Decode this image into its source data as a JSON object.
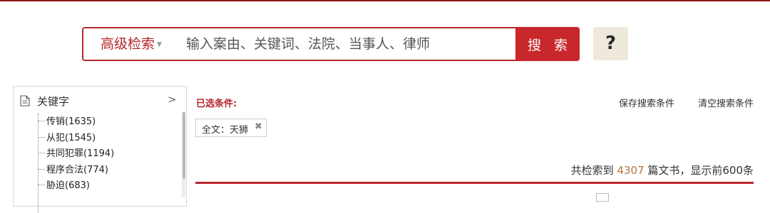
{
  "search": {
    "advanced_label": "高级检索",
    "placeholder": "输入案由、关键词、法院、当事人、律师",
    "value": "",
    "button_label": "搜 索",
    "help_label": "?"
  },
  "sidebar": {
    "title": "关键字",
    "arrow": ">",
    "items": [
      {
        "label": "传销(1635)"
      },
      {
        "label": "从犯(1545)"
      },
      {
        "label": "共同犯罪(1194)"
      },
      {
        "label": "程序合法(774)"
      },
      {
        "label": "胁迫(683)"
      }
    ]
  },
  "filters": {
    "selected_label": "已选条件:",
    "save_label": "保存搜索条件",
    "clear_label": "清空搜索条件",
    "chips": [
      {
        "text": "全文：天狮"
      }
    ]
  },
  "results": {
    "prefix": "共检索到 ",
    "count": "4307",
    "suffix": " 篇文书，显示前600条"
  },
  "colors": {
    "accent": "#c8272c",
    "help_bg": "#efe9dc",
    "count_color": "#b0783e"
  }
}
